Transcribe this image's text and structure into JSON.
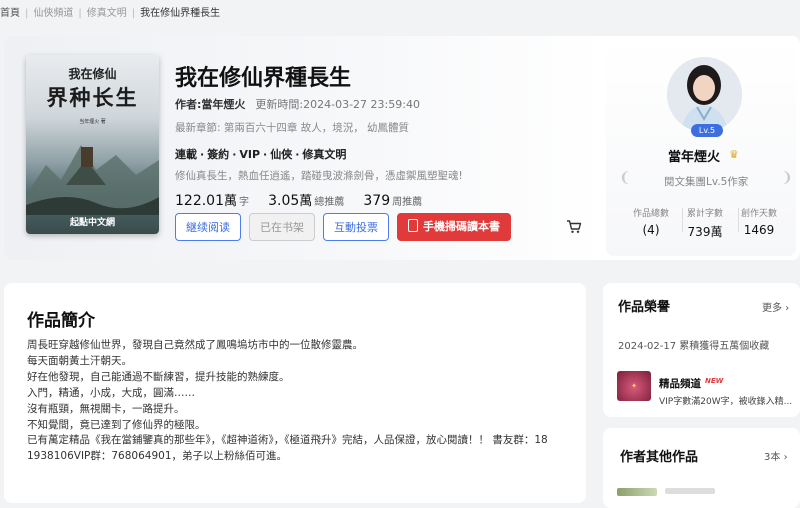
{
  "breadcrumb": [
    "首頁",
    "仙俠頻道",
    "修真文明",
    "我在修仙界種長生"
  ],
  "cover": {
    "line1": "我在修仙",
    "line2": "界种长生",
    "author_small": "当年煙火 著",
    "publisher": "起點中文網"
  },
  "book": {
    "title": "我在修仙界種長生",
    "author_label": "作者:",
    "author": "當年煙火",
    "updated_label": "更新時間:",
    "updated": "2024-03-27 23:59:40",
    "latest": "最新章節: 第兩百六十四章 故人，境況， 幼鳳體質",
    "tags": [
      "連載",
      "簽約",
      "VIP",
      "仙俠",
      "修真文明"
    ],
    "intro_line": "修仙真長生，熱血任逍遙，踏碰曳波滌劍骨，憑虛禦風塑聖魂!",
    "stats": [
      {
        "num": "122.01",
        "unit": "萬",
        "label": "字"
      },
      {
        "num": "3.05",
        "unit": "萬",
        "label": "總推薦"
      },
      {
        "num": "379",
        "unit": "",
        "label": "周推薦"
      }
    ]
  },
  "buttons": {
    "read": "継续阅读",
    "shelf": "已在书架",
    "vote": "互動投票",
    "phone": "手機掃碼讀本書"
  },
  "author_panel": {
    "level": "Lv.5",
    "name": "當年煙火",
    "rank": "閱文集團Lv.5作家",
    "stats": [
      {
        "label": "作品總數",
        "value": "4"
      },
      {
        "label": "累計字數",
        "value": "739萬"
      },
      {
        "label": "創作天數",
        "value": "1469"
      }
    ]
  },
  "intro": {
    "title": "作品簡介",
    "lines": [
      "周長旺穿越修仙世界，發現自己竟然成了鳳鳴塢坊市中的一位散修靈農。",
      "每天面朝黃土汗朝天。",
      "好在他發現，自己能通過不斷練習，提升技能的熟練度。",
      "入門，精通，小成，大成，圓滿……",
      "沒有瓶頸，無視關卡，一路提升。",
      "不知覺間，竟已達到了修仙界的極限。",
      "已有萬定精品《我在當鋪鑒真的那些年》，《超神道術》，《極道飛升》完結，人品保證，放心閱讀！！ 書友群：18",
      "1938106VIP群：768064901，弟子以上粉絲佰可進。"
    ]
  },
  "honors": {
    "title": "作品榮譽",
    "more": "更多",
    "item": "2024-02-17 累積獲得五萬個收藏",
    "channel_name": "精品頻道",
    "new_badge": "NEW",
    "channel_desc": "VIP字數滿20W字，被收錄入精..."
  },
  "other_works": {
    "title": "作者其他作品",
    "more": "3本"
  },
  "colors": {
    "accent_blue": "#3b6ee0",
    "primary_red": "#e13a3a",
    "page_bg": "#f2f3f5"
  }
}
